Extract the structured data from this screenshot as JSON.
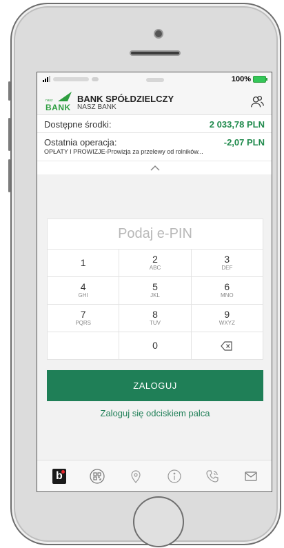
{
  "status_bar": {
    "battery_percent": "100%"
  },
  "header": {
    "bank_name": "BANK SPÓŁDZIELCZY",
    "bank_subname": "NASZ BANK",
    "logo_small": "nasz",
    "logo_text": "BANK"
  },
  "account": {
    "available_label": "Dostępne środki:",
    "available_value": "2 033,78 PLN",
    "last_op_label": "Ostatnia operacja:",
    "last_op_value": "-2,07 PLN",
    "last_op_desc": "OPŁATY I PROWIZJE-Prowizja za przelewy od rolników..."
  },
  "pin": {
    "placeholder": "Podaj e-PIN"
  },
  "keypad": {
    "k1": {
      "num": "1",
      "letters": ""
    },
    "k2": {
      "num": "2",
      "letters": "ABC"
    },
    "k3": {
      "num": "3",
      "letters": "DEF"
    },
    "k4": {
      "num": "4",
      "letters": "GHI"
    },
    "k5": {
      "num": "5",
      "letters": "JKL"
    },
    "k6": {
      "num": "6",
      "letters": "MNO"
    },
    "k7": {
      "num": "7",
      "letters": "PQRS"
    },
    "k8": {
      "num": "8",
      "letters": "TUV"
    },
    "k9": {
      "num": "9",
      "letters": "WXYZ"
    },
    "k0": {
      "num": "0",
      "letters": ""
    }
  },
  "actions": {
    "login_label": "ZALOGUJ",
    "fingerprint_label": "Zaloguj się odciskiem palca"
  },
  "tabbar": {
    "b_label": "b"
  },
  "colors": {
    "brand_green": "#1f7f57",
    "amount_green": "#1f8a4c"
  }
}
